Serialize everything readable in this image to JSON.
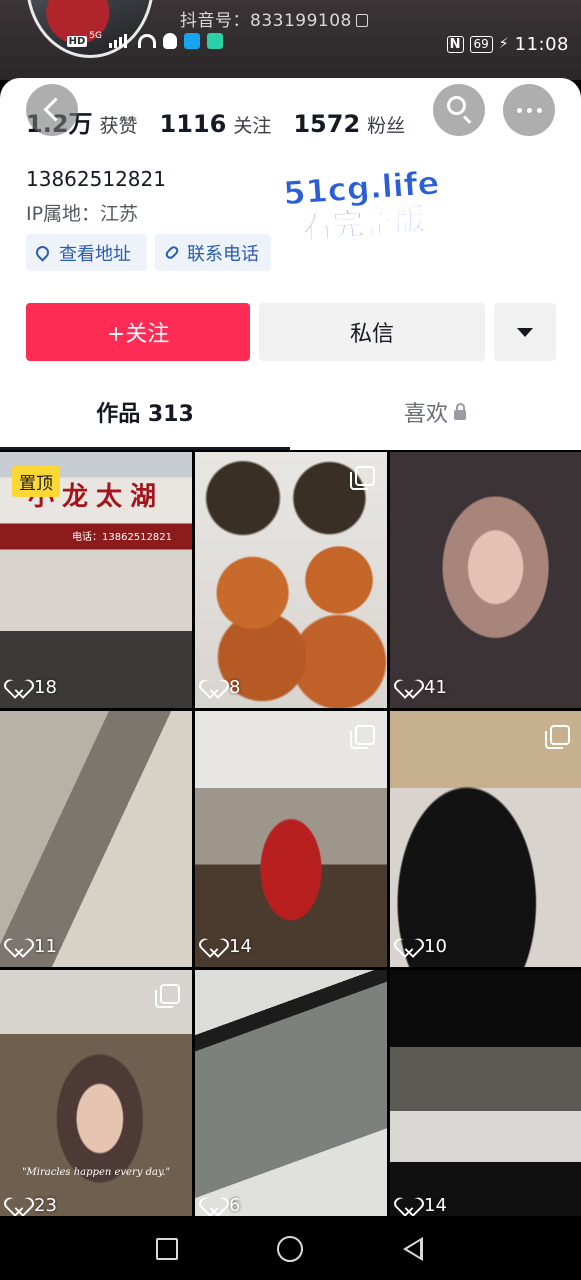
{
  "header": {
    "douyin_id": "抖音号：833199108"
  },
  "status_bar": {
    "hd": "HD",
    "net": "5G",
    "nfc": "N",
    "battery": "69",
    "time": "11:08"
  },
  "profile": {
    "stats": [
      {
        "value": "1.2万",
        "label": "获赞"
      },
      {
        "value": "1116",
        "label": "关注"
      },
      {
        "value": "1572",
        "label": "粉丝"
      }
    ],
    "phone": "13862512821",
    "ip_location": "IP属地：江苏",
    "tags": {
      "address": "查看地址",
      "phone": "联系电话"
    },
    "watermark": {
      "line1": "51cg.life",
      "line2": "看完整版"
    },
    "actions": {
      "follow": "+关注",
      "message": "私信"
    }
  },
  "tabs": {
    "works": "作品 313",
    "likes": "喜欢"
  },
  "grid": {
    "pinned_badge": "置顶",
    "items": [
      {
        "likes": "18",
        "sign": "小龙太湖",
        "sign_phone": "电话：13862512821"
      },
      {
        "likes": "8"
      },
      {
        "likes": "41"
      },
      {
        "likes": "11"
      },
      {
        "likes": "14"
      },
      {
        "likes": "10"
      },
      {
        "likes": "23",
        "caption": "\"Miracles happen every day.\""
      },
      {
        "likes": "6"
      },
      {
        "likes": "14"
      }
    ]
  },
  "colors": {
    "primary": "#fe2c55",
    "tag_text": "#2b5bb2",
    "watermark": "#2a5fd8"
  }
}
